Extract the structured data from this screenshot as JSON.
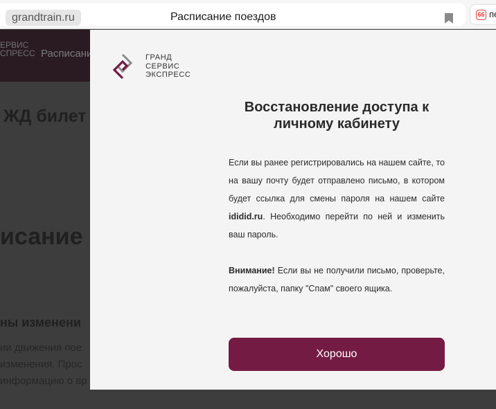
{
  "browser": {
    "domain": "grandtrain.ru",
    "page_title": "Расписание поездов",
    "bookmark_icon": "bookmark-icon",
    "extension_icon_text": "66",
    "extension_text": "пе"
  },
  "background_page": {
    "logo_lines": [
      "ЕРВИС",
      "СПРЕСС"
    ],
    "nav_item": "Расписание",
    "heading_tickets": "ЖД билет",
    "heading_schedule": "исание",
    "heading_changes": "ны изменени",
    "paragraph_lines": [
      "ии движения пое",
      "изменения. Прос",
      "информацию о вр"
    ]
  },
  "modal": {
    "brand_lines": [
      "ГРАНД",
      "СЕРВИС",
      "ЭКСПРЕСС"
    ],
    "title": "Восстановление доступа к личному кабинету",
    "p1_before": "Если вы ранее регистрировались на нашем сайте, то на вашу почту будет отправлено письмо, в котором будет ссылка для смены пароля на нашем сайте ",
    "p1_site": "ididid.ru",
    "p1_after": ". Необходимо перейти по ней и изменить ваш пароль.",
    "p2_label": "Внимание!",
    "p2_text": " Если вы не получили письмо, проверьте, пожалуйста, папку \"Спам\" своего ящика.",
    "ok_button": "Хорошо",
    "accent_color": "#741b43"
  }
}
